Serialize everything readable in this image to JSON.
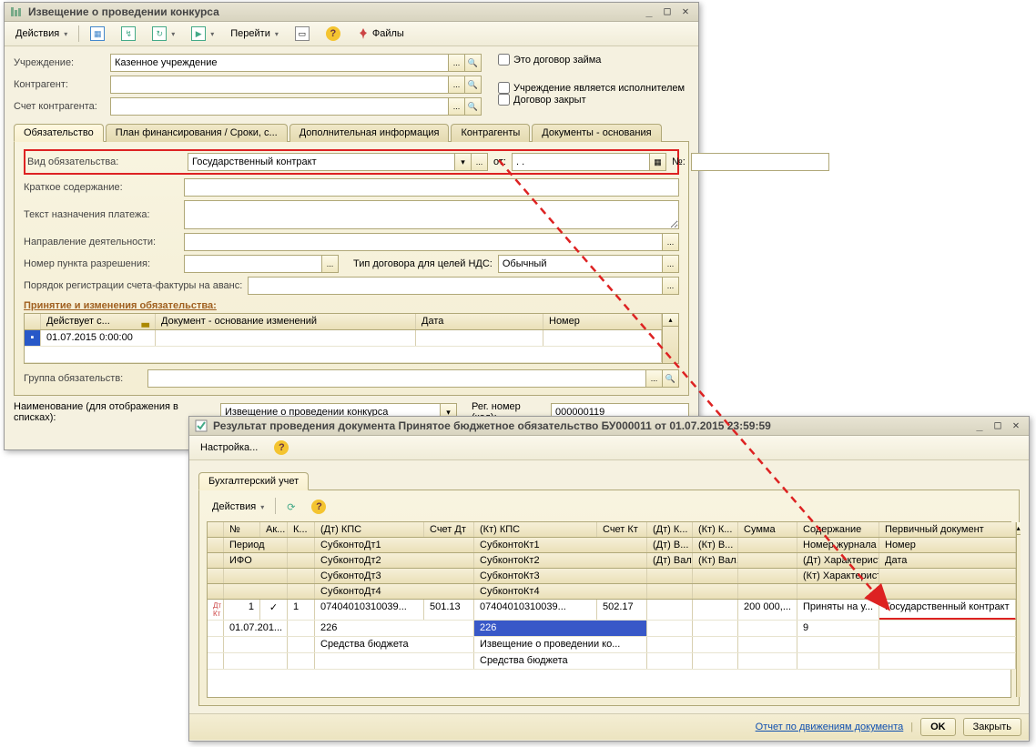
{
  "win1": {
    "title": "Извещение о проведении конкурса",
    "toolbar": {
      "actions": "Действия",
      "nav": "Перейти",
      "files": "Файлы"
    },
    "fields": {
      "org_lbl": "Учреждение:",
      "org_val": "Казенное учреждение",
      "contractor_lbl": "Контрагент:",
      "acct_lbl": "Счет контрагента:",
      "loan_chk": "Это договор займа",
      "exec_chk": "Учреждение является исполнителем",
      "closed_chk": "Договор закрыт"
    },
    "tabs": {
      "t1": "Обязательство",
      "t2": "План финансирования / Сроки, с...",
      "t3": "Дополнительная информация",
      "t4": "Контрагенты",
      "t5": "Документы - основания"
    },
    "panel": {
      "kind_lbl": "Вид обязательства:",
      "kind_val": "Государственный контракт",
      "from_lbl": "от:",
      "from_val": ". .",
      "num_lbl": "№:",
      "brief_lbl": "Краткое содержание:",
      "paytext_lbl": "Текст назначения платежа:",
      "dir_lbl": "Направление деятельности:",
      "permnum_lbl": "Номер пункта разрешения:",
      "vat_lbl": "Тип договора для целей НДС:",
      "vat_val": "Обычный",
      "invreg_lbl": "Порядок регистрации счета-фактуры на аванс:",
      "section": "Принятие и изменения обязательства:",
      "table": {
        "c1": "Действует с...",
        "c2": "Документ - основание изменений",
        "c3": "Дата",
        "c4": "Номер",
        "r1c1": "01.07.2015 0:00:00"
      },
      "group_lbl": "Группа обязательств:"
    },
    "bottom": {
      "display_lbl": "Наименование (для отображения в списках):",
      "display_val": "Извещение о проведении конкурса",
      "regnum_lbl": "Рег. номер (код):",
      "regnum_val": "000000119"
    }
  },
  "win2": {
    "title": "Результат проведения документа Принятое бюджетное обязательство БУ000011 от 01.07.2015 23:59:59",
    "toolbar": {
      "settings": "Настройка..."
    },
    "tab": "Бухгалтерский учет",
    "actions": "Действия",
    "headers": {
      "n": "№",
      "ak": "Ак...",
      "k": "К...",
      "dtkps": "(Дт) КПС",
      "schdt": "Счет Дт",
      "ktkps": "(Кт) КПС",
      "schkt": "Счет Кт",
      "dtk": "(Дт) К...",
      "ktk": "(Кт) К...",
      "sum": "Сумма",
      "content": "Содержание",
      "doc": "Первичный документ",
      "period": "Период",
      "sdt1": "СубконтоДт1",
      "skt1": "СубконтоКт1",
      "dtv": "(Дт) В...",
      "ktv": "(Кт) В...",
      "journal": "Номер журнала",
      "num": "Номер",
      "ifo": "ИФО",
      "sdt2": "СубконтоДт2",
      "skt2": "СубконтоКт2",
      "dtval": "(Дт) Вал. сумма",
      "ktval": "(Кт) Вал. сумма",
      "dtchar": "(Дт) Характерист...",
      "date": "Дата",
      "sdt3": "СубконтоДт3",
      "skt3": "СубконтоКт3",
      "ktchar": "(Кт) Характеристи...",
      "sdt4": "СубконтоДт4",
      "skt4": "СубконтоКт4"
    },
    "row": {
      "n": "1",
      "ak": "✓",
      "k": "1",
      "dtkps": "07404010310039...",
      "schdt": "501.13",
      "ktkps": "07404010310039...",
      "schkt": "502.17",
      "sum": "200 000,...",
      "content": "Приняты на у...",
      "doc": "Государственный контракт",
      "period": "01.07.201...",
      "sdt2": "226",
      "skt2": "226",
      "journal": "9",
      "sdt3": "Средства бюджета",
      "skt3": "Извещение о проведении ко...",
      "skt4": "Средства бюджета"
    },
    "footer": {
      "report": "Отчет по движениям документа",
      "ok": "OK",
      "close": "Закрыть"
    }
  }
}
